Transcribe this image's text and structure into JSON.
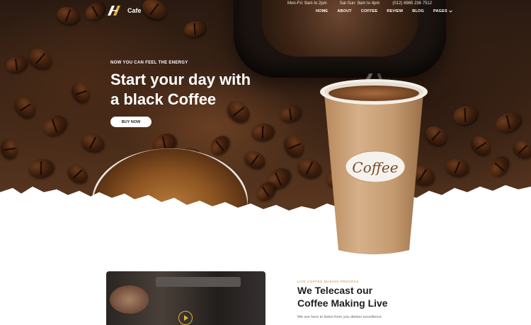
{
  "header": {
    "brand": "Cafe",
    "hours_weekday": "Mon-Fri: 9am to 2pm",
    "hours_weekend": "Sat-Sun: 9am to 4pm",
    "phone": "(012) 6985 236 7512",
    "nav": [
      {
        "label": "HOME"
      },
      {
        "label": "ABOUT"
      },
      {
        "label": "COFFEE"
      },
      {
        "label": "REVIEW"
      },
      {
        "label": "BLOG"
      },
      {
        "label": "PAGES"
      }
    ]
  },
  "hero": {
    "eyebrow": "NOW YOU CAN FEEL THE ENERGY",
    "headline_line1": "Start your day with",
    "headline_line2": "a black Coffee",
    "cta_label": "BUY NOW",
    "cup_label": "Coffee"
  },
  "live": {
    "eyebrow": "LIVE COFFEE MAKING PROCESS",
    "title_line1": "We Telecast our",
    "title_line2": "Coffee Making Live",
    "description": "We are here to listen from you deliver excellence"
  },
  "colors": {
    "accent": "#c8863a",
    "play": "#e0b52e",
    "dark": "#2a1a11"
  },
  "icons": {
    "logo": "logo-mark-icon",
    "dropdown": "chevron-down-icon",
    "play": "play-icon"
  }
}
